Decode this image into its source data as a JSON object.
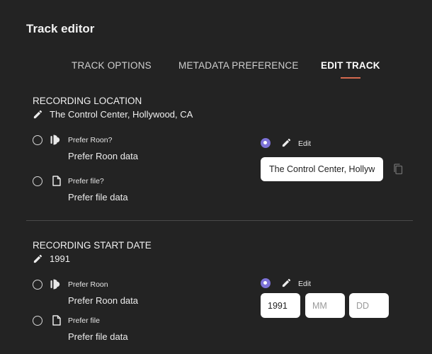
{
  "window": {
    "title": "Track editor"
  },
  "tabs": [
    {
      "label": "TRACK OPTIONS",
      "active": false
    },
    {
      "label": "METADATA PREFERENCE",
      "active": false
    },
    {
      "label": "EDIT TRACK",
      "active": true
    }
  ],
  "recording_location": {
    "title": "RECORDING LOCATION",
    "current_value": "The Control Center, Hollywood, CA",
    "options": {
      "roon": {
        "label": "Prefer Roon?",
        "data": "Prefer Roon data",
        "selected": false
      },
      "file": {
        "label": "Prefer file?",
        "data": "Prefer file data",
        "selected": false
      },
      "edit": {
        "label": "Edit",
        "selected": true,
        "value": "The Control Center, Hollywood, CA"
      }
    }
  },
  "recording_start_date": {
    "title": "RECORDING START DATE",
    "current_value": "1991",
    "options": {
      "roon": {
        "label": "Prefer Roon",
        "data": "Prefer Roon data",
        "selected": false
      },
      "file": {
        "label": "Prefer file",
        "data": "Prefer file data",
        "selected": false
      },
      "edit": {
        "label": "Edit",
        "selected": true,
        "year": "1991",
        "month_placeholder": "MM",
        "day_placeholder": "DD"
      }
    }
  },
  "icons": {
    "section_value": "pencil-icon",
    "roon": "roon-logo-icon",
    "file": "file-icon",
    "edit": "pencil-icon",
    "copy": "copy-icon"
  },
  "colors": {
    "background": "#232323",
    "accent_radio": "#7d72d8",
    "tab_underline": "#d46a4f"
  }
}
